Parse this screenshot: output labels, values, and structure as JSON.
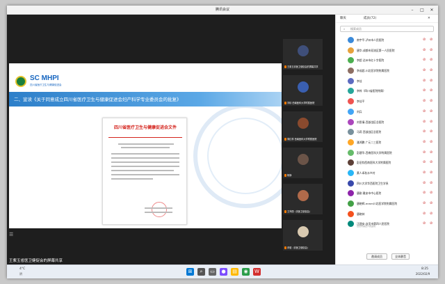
{
  "window": {
    "title": "腾讯会议"
  },
  "share": {
    "brand": "SC MHPI",
    "brand_sub": "四川省医疗卫生与健康促进会",
    "banner": "二、宣读《关于同意成立四川省医疗卫生与健康促进会妇产科学专业委员会的批复》",
    "doc_title": "四川省医疗卫生与健康促进会文件",
    "presenter_label": "王紫玉省医卫健促会的屏幕共享"
  },
  "gallery": [
    {
      "name": "王紫玉省医卫健促会的屏幕共享",
      "color": "#3f4f7a"
    },
    {
      "name": "刘珍 西南医科大学附属医院",
      "color": "#3a5fb0"
    },
    {
      "name": "周红林 西南医科大学附属医院",
      "color": "#8a4a2e"
    },
    {
      "name": "杨静",
      "color": "#6b5448"
    },
    {
      "name": "王萍丽（省医卫健促会）",
      "color": "#b06a4a"
    },
    {
      "name": "邓健（省医卫健促会）",
      "color": "#d8c9b0"
    }
  ],
  "panel": {
    "tab_left": "聊天",
    "tab_right": "成员(72)",
    "search_placeholder": "搜索成员",
    "members": [
      {
        "name": "南宇平-泸州市人民医院",
        "color": "#3b8ad9"
      },
      {
        "name": "唐华-成都市双流区第一人民医院",
        "color": "#e6a23c"
      },
      {
        "name": "李超 达州市红十字医院",
        "color": "#4caf50"
      },
      {
        "name": "李成超-川北医学院附属医院",
        "color": "#8d6e63"
      },
      {
        "name": "李佳",
        "color": "#5c6bc0"
      },
      {
        "name": "李梓（四川省医院附属）",
        "color": "#26a69a"
      },
      {
        "name": "李佳平",
        "color": "#ef5350"
      },
      {
        "name": "刘兵",
        "color": "#42a5f5"
      },
      {
        "name": "刘思倩-西部战区总医院",
        "color": "#ab47bc"
      },
      {
        "name": "马莉 西部战区总医院",
        "color": "#78909c"
      },
      {
        "name": "潘鸿鹏 广元二三医院",
        "color": "#ffa726"
      },
      {
        "name": "彭建华-西南医科大学附属医院",
        "color": "#66bb6a"
      },
      {
        "name": "彭旧钧西南医科大学附属医院",
        "color": "#5d4037"
      },
      {
        "name": "黄人禾秋水乡村",
        "color": "#29b6f6"
      },
      {
        "name": "四川大学华西医院卫生学系",
        "color": "#3949ab"
      },
      {
        "name": "唐刚 雅安市中心医院",
        "color": "#8e24aa"
      },
      {
        "name": "唐晓辉-mmm川北医学院附属医院",
        "color": "#43a047"
      },
      {
        "name": "唐晓林",
        "color": "#f4511e"
      },
      {
        "name": "汪理安-自贡市第四人民医院",
        "color": "#00897b",
        "sub": "自贡市第四人民医院"
      }
    ],
    "btn_manage": "邀请成员",
    "btn_mute": "全体静音"
  },
  "taskbar": {
    "weather_temp": "4°C",
    "weather_desc": "阴",
    "time": "8:25",
    "date": "2022/02/9"
  }
}
